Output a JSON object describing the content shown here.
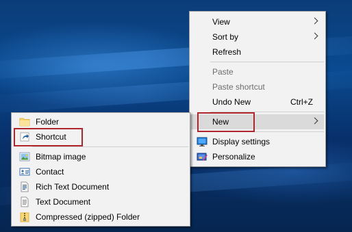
{
  "context_menu": {
    "items": {
      "view": "View",
      "sort_by": "Sort by",
      "refresh": "Refresh",
      "paste": "Paste",
      "paste_shortcut": "Paste shortcut",
      "undo_new": "Undo New",
      "undo_new_accel": "Ctrl+Z",
      "new": "New",
      "display_settings": "Display settings",
      "personalize": "Personalize"
    }
  },
  "new_submenu": {
    "items": {
      "folder": "Folder",
      "shortcut": "Shortcut",
      "bitmap_image": "Bitmap image",
      "contact": "Contact",
      "rich_text_document": "Rich Text Document",
      "text_document": "Text Document",
      "compressed_folder": "Compressed (zipped) Folder"
    }
  },
  "colors": {
    "menu_background": "#f2f2f2",
    "highlight_box": "#b0242b",
    "hover_background": "#dadada",
    "disabled_text": "#6d6d6d"
  },
  "icons": {
    "folder": "folder-icon",
    "shortcut": "shortcut-icon",
    "bitmap_image": "bitmap-image-icon",
    "contact": "contact-icon",
    "rich_text_document": "rich-text-document-icon",
    "text_document": "text-document-icon",
    "compressed_folder": "zip-folder-icon",
    "display_settings": "display-settings-icon",
    "personalize": "personalize-icon"
  }
}
